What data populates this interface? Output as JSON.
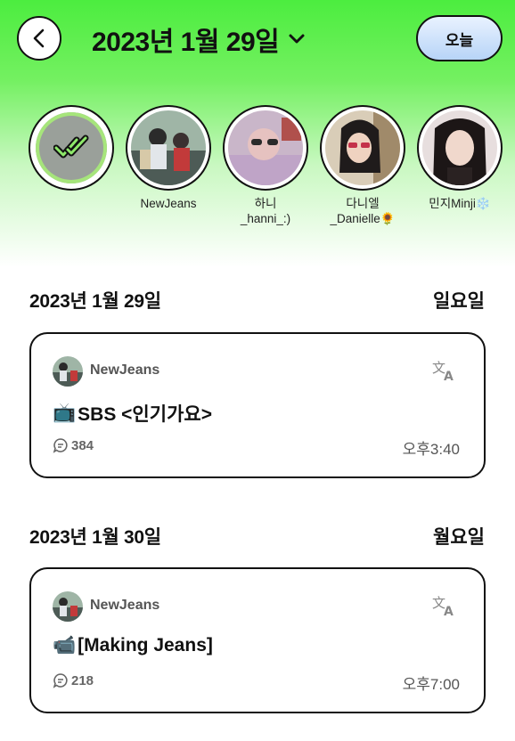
{
  "header": {
    "date_title": "2023년 1월 29일",
    "today_label": "오늘"
  },
  "stories": [
    {
      "name": "",
      "selected": true
    },
    {
      "name": "NewJeans"
    },
    {
      "name_line1": "하니",
      "name_line2": "_hanni_:)"
    },
    {
      "name_line1": "다니엘",
      "name_line2": "_Danielle🌻"
    },
    {
      "name": "민지Minji❄️"
    }
  ],
  "sections": [
    {
      "date": "2023년 1월 29일",
      "weekday": "일요일",
      "post": {
        "author": "NewJeans",
        "emoji": "📺",
        "title": "SBS <인기가요>",
        "comments": "384",
        "time": "오후3:40"
      }
    },
    {
      "date": "2023년 1월 30일",
      "weekday": "월요일",
      "post": {
        "author": "NewJeans",
        "emoji": "📹",
        "title": "[Making Jeans]",
        "comments": "218",
        "time": "오후7:00"
      }
    }
  ],
  "colors": {
    "accent_green": "#4ced3f",
    "today_button": "#b7d4f7"
  }
}
